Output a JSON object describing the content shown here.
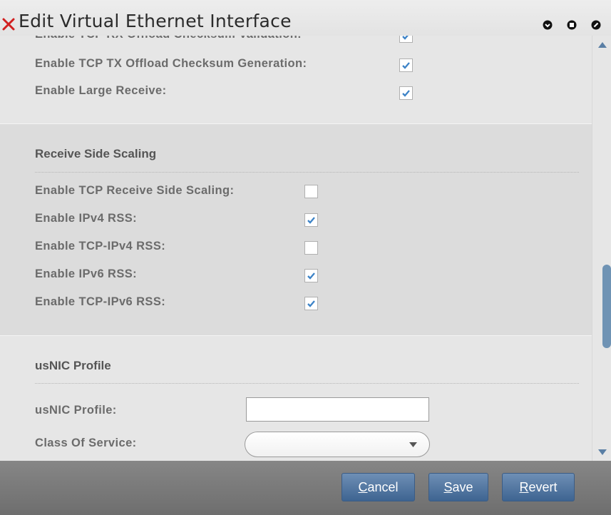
{
  "window": {
    "title": "Edit Virtual Ethernet Interface"
  },
  "offload": {
    "items": [
      {
        "label": "Enable TCP RX Offload Checksum Validation:",
        "checked": true
      },
      {
        "label": "Enable TCP TX Offload Checksum Generation:",
        "checked": true
      },
      {
        "label": "Enable Large Receive:",
        "checked": true
      }
    ]
  },
  "rss": {
    "title": "Receive Side Scaling",
    "items": [
      {
        "label": "Enable TCP Receive Side Scaling:",
        "checked": false
      },
      {
        "label": "Enable IPv4 RSS:",
        "checked": true
      },
      {
        "label": "Enable TCP-IPv4 RSS:",
        "checked": false
      },
      {
        "label": "Enable IPv6 RSS:",
        "checked": true
      },
      {
        "label": "Enable TCP-IPv6 RSS:",
        "checked": true
      }
    ]
  },
  "usnic": {
    "title": "usNIC Profile",
    "profile_label": "usNIC Profile:",
    "profile_value": "",
    "cos_label": "Class Of Service:",
    "cos_value": ""
  },
  "footer": {
    "cancel": {
      "mnemonic": "C",
      "rest": "ancel"
    },
    "save": {
      "mnemonic": "S",
      "rest": "ave"
    },
    "revert": {
      "mnemonic": "R",
      "rest": "evert"
    }
  },
  "colors": {
    "accent": "#3e6491",
    "check": "#3d83c7",
    "close_x": "#d11f1f",
    "scroll_thumb": "#6f93b4"
  }
}
